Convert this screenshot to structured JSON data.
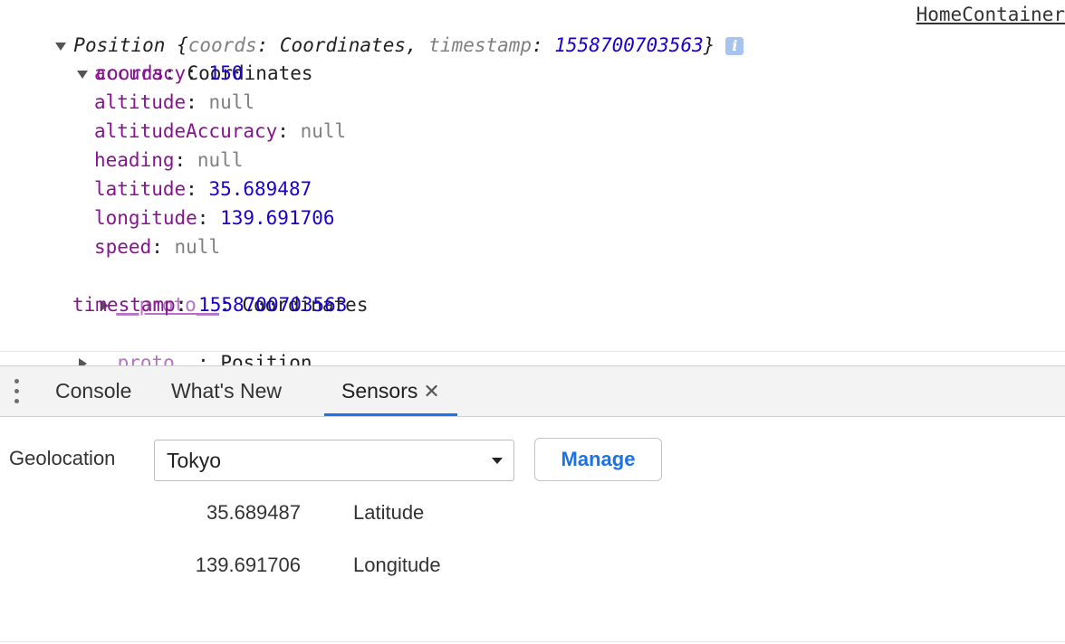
{
  "console": {
    "position_line": {
      "name": "Position",
      "preview_open": " {",
      "coords_key": "coords",
      "sep1": ": ",
      "coords_type": "Coordinates",
      "comma": ", ",
      "timestamp_key": "timestamp",
      "sep2": ": ",
      "timestamp_value": "1558700703563",
      "preview_close": "}",
      "info_glyph": "i"
    },
    "source_link": "HomeContainer",
    "coords_line": {
      "key": "coords",
      "sep": ": ",
      "type": "Coordinates"
    },
    "properties": [
      {
        "key": "accuracy",
        "sep": ": ",
        "value": "150"
      },
      {
        "key": "altitude",
        "sep": ": ",
        "value": "null"
      },
      {
        "key": "altitudeAccuracy",
        "sep": ": ",
        "value": "null"
      },
      {
        "key": "heading",
        "sep": ": ",
        "value": "null"
      },
      {
        "key": "latitude",
        "sep": ": ",
        "value": "35.689487"
      },
      {
        "key": "longitude",
        "sep": ": ",
        "value": "139.691706"
      },
      {
        "key": "speed",
        "sep": ": ",
        "value": "null"
      }
    ],
    "coords_proto": {
      "key": "__proto__",
      "sep": ": ",
      "type": "Coordinates"
    },
    "timestamp_line": {
      "key": "timestamp",
      "sep": ": ",
      "value": "1558700703563"
    },
    "position_proto": {
      "key": "__proto__",
      "sep": ": ",
      "type": "Position"
    }
  },
  "drawer": {
    "tabs": [
      {
        "label": "Console"
      },
      {
        "label": "What's New"
      },
      {
        "label": "Sensors",
        "close": "✕"
      }
    ],
    "active_tab": "Sensors",
    "accent_color": "#1a73e8"
  },
  "sensors": {
    "geolocation_label": "Geolocation",
    "selected_location": "Tokyo",
    "manage_label": "Manage",
    "latitude_value": "35.689487",
    "latitude_label": "Latitude",
    "longitude_value": "139.691706",
    "longitude_label": "Longitude"
  }
}
